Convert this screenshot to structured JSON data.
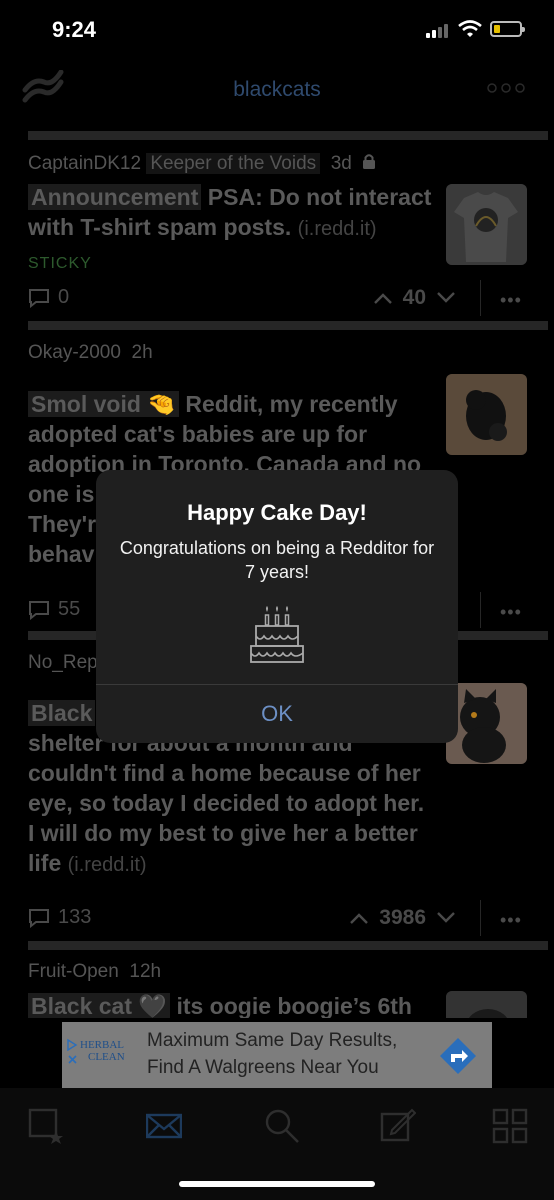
{
  "status_bar": {
    "time": "9:24"
  },
  "nav": {
    "title": "blackcats"
  },
  "posts": [
    {
      "author": "CaptainDK12",
      "author_flair": "Keeper of the Voids",
      "age": "3d",
      "post_flair": "Announcement",
      "title": "PSA: Do not interact with T-shirt spam posts.",
      "domain": "(i.redd.it)",
      "sticky_label": "STICKY",
      "comments": "0",
      "score": "40"
    },
    {
      "author": "Okay-2000",
      "age": "2h",
      "post_flair": "Smol void 🤏",
      "title_visible": "Reddit, my recently adopted cat's babies are up for adoption in Toronto, Canada and no",
      "line_one_is": "one is",
      "line_theyr": "They'r",
      "line_behav": "behav",
      "comments": "55"
    },
    {
      "author_partial": "No_Rep",
      "post_flair_partial": "Black",
      "title_lines": [
        "shelter for about a month and",
        "couldn't find a home because of her",
        "eye, so today I decided to adopt her.",
        "I will do my best to give her a better",
        "life"
      ],
      "domain": "(i.redd.it)",
      "comments": "133",
      "score": "3986"
    },
    {
      "author": "Fruit-Open",
      "age": "12h",
      "post_flair": "Black cat 🖤",
      "title": "its oogie boogie’s 6th"
    }
  ],
  "ad": {
    "line1": "Maximum Same Day Results,",
    "line2": "Find A Walgreens Near You",
    "brand_line1": "HERBAL",
    "brand_line2": "CLEAN"
  },
  "modal": {
    "title": "Happy Cake Day!",
    "message": "Congratulations on being a Redditor for 7 years!",
    "ok_label": "OK"
  },
  "colors": {
    "modal_button": "#6c8fc4",
    "nav_title": "#2f4a6e",
    "sticky": "#2d5a2d"
  }
}
